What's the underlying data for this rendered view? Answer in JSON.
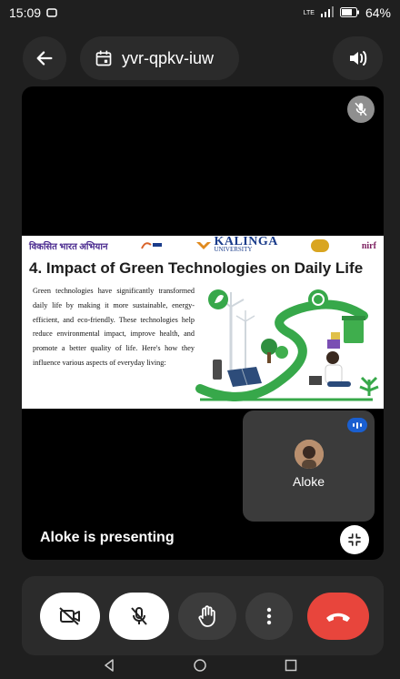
{
  "status": {
    "time": "15:09",
    "network_badge": "LTE",
    "battery": "64%"
  },
  "top_bar": {
    "meeting_code": "yvr-qpkv-iuw"
  },
  "slide": {
    "logos": {
      "left_text": "विकसित भारत अभियान",
      "university_name": "KALINGA",
      "university_sub": "UNIVERSITY",
      "right_text": "nirf"
    },
    "title": "4. Impact of Green Technologies on Daily Life",
    "body": "Green technologies have significantly transformed daily life by making it more sustainable, energy-efficient, and eco-friendly. These technologies help reduce environmental impact, improve health, and promote a better quality of life. Here's how they influence various aspects of everyday living:"
  },
  "pip": {
    "name": "Aloke"
  },
  "presenting_label": "Aloke is presenting",
  "colors": {
    "background": "#1f1f1f",
    "surface": "#2b2b2b",
    "end_call": "#e8453c",
    "speaking_indicator": "#1a5fd0",
    "slide_green": "#37a84a"
  },
  "controls": {
    "icons": [
      "camera-off-icon",
      "mic-off-icon",
      "raise-hand-icon",
      "more-vert-icon",
      "end-call-icon"
    ]
  }
}
